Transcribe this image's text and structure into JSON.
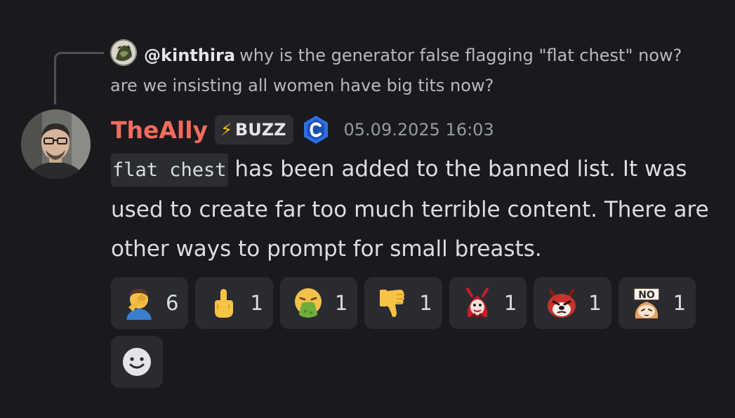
{
  "reply": {
    "username": "@kinthira",
    "text": "why is the generator false flagging \"flat chest\" now? are we insisting all women have big tits now?"
  },
  "message": {
    "author": "TheAlly",
    "author_color": "#f06c5e",
    "badge_label": "BUZZ",
    "badge_icon": "lightning-bolt-icon",
    "role_icon": "creator-c-icon",
    "timestamp": "05.09.2025 16:03",
    "code": "flat chest",
    "text": " has been added to the banned list. It was used to create far too much terrible content. There are other ways to prompt for small breasts."
  },
  "reactions": [
    {
      "icon": "facepalm-emoji",
      "count": "6"
    },
    {
      "icon": "middle-finger-emoji",
      "count": "1"
    },
    {
      "icon": "vomit-face-emoji",
      "count": "1"
    },
    {
      "icon": "thumbs-down-emoji",
      "count": "1"
    },
    {
      "icon": "red-demon-emoji",
      "count": "1"
    },
    {
      "icon": "angry-red-panda-emoji",
      "count": "1"
    },
    {
      "icon": "no-sign-anime-emoji",
      "count": "1"
    }
  ],
  "add_reaction_icon": "smiley-face-icon"
}
